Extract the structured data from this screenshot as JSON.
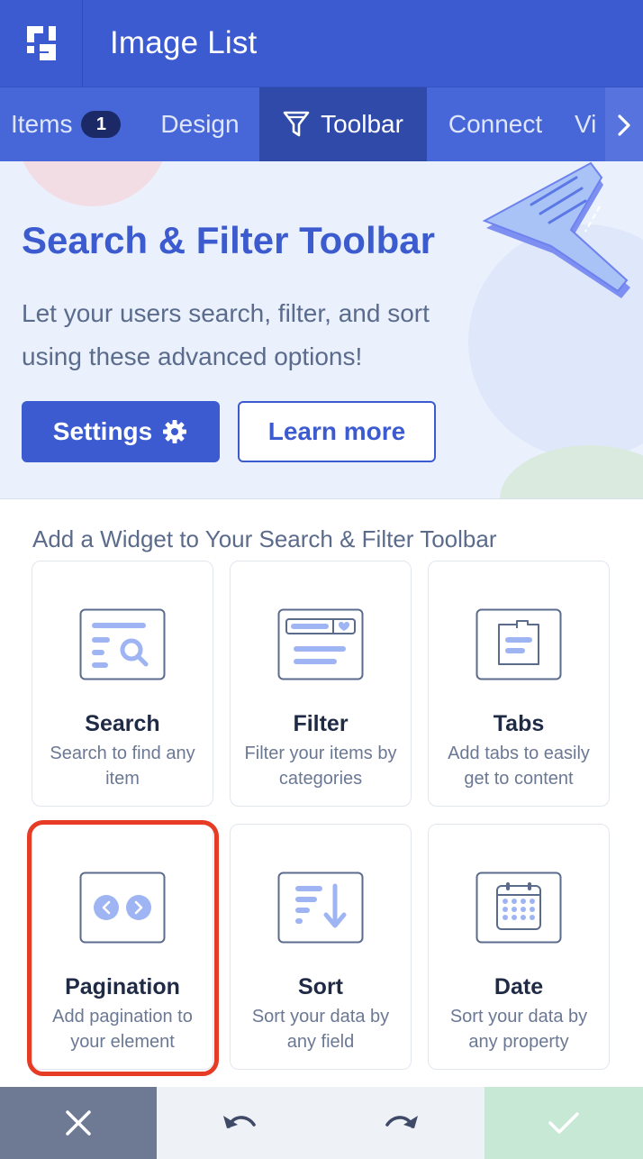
{
  "header": {
    "title": "Image List",
    "logo_icon": "app-logo-icon"
  },
  "tabs": {
    "items": {
      "label": "Items",
      "badge": "1"
    },
    "design": {
      "label": "Design"
    },
    "toolbar": {
      "label": "Toolbar",
      "icon": "funnel-icon"
    },
    "connect": {
      "label": "Connect"
    },
    "more": {
      "label": "Vi"
    }
  },
  "hero": {
    "title": "Search & Filter Toolbar",
    "description": "Let your users search, filter, and sort using these advanced options!",
    "settings_label": "Settings",
    "learn_more_label": "Learn more"
  },
  "widgets": {
    "section_title": "Add a Widget to Your Search & Filter Toolbar",
    "cards": [
      {
        "title": "Search",
        "description": "Search to find any item",
        "icon": "search-widget-icon"
      },
      {
        "title": "Filter",
        "description": "Filter your items by categories",
        "icon": "filter-widget-icon"
      },
      {
        "title": "Tabs",
        "description": "Add tabs to easily get to content",
        "icon": "tabs-widget-icon"
      },
      {
        "title": "Pagination",
        "description": "Add pagination to your element",
        "icon": "pagination-widget-icon"
      },
      {
        "title": "Sort",
        "description": "Sort your data by any field",
        "icon": "sort-widget-icon"
      },
      {
        "title": "Date",
        "description": "Sort your data by any property",
        "icon": "calendar-widget-icon"
      }
    ]
  },
  "colors": {
    "primary": "#3c5bd0",
    "highlight": "#e63b25",
    "hero_bg": "#eaf1fd"
  }
}
